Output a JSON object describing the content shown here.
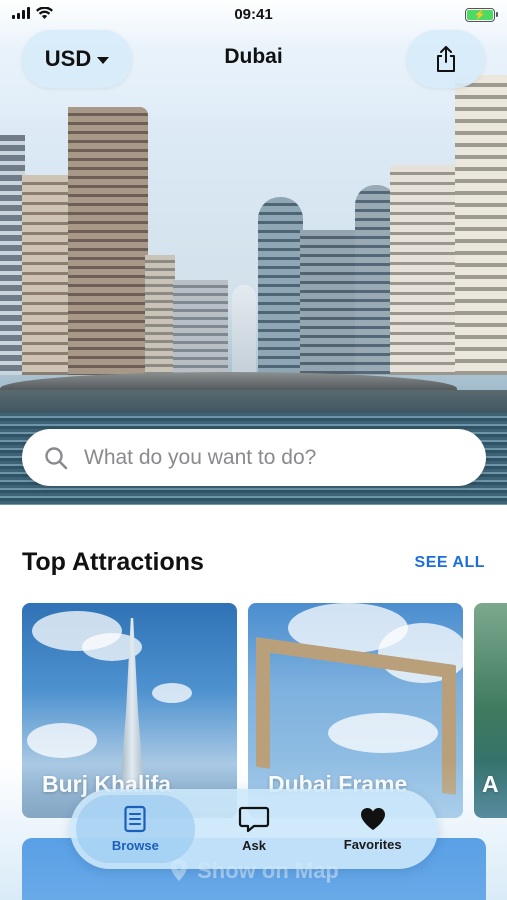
{
  "status_bar": {
    "time": "09:41"
  },
  "header": {
    "currency": "USD",
    "city": "Dubai"
  },
  "search": {
    "placeholder": "What do you want to do?"
  },
  "attractions": {
    "title": "Top Attractions",
    "see_all": "SEE ALL",
    "cards": [
      {
        "label": "Burj Khalifa"
      },
      {
        "label": "Dubai Frame"
      },
      {
        "label": "A"
      }
    ]
  },
  "map_button": {
    "label": "Show on Map"
  },
  "tab_bar": {
    "tabs": [
      {
        "label": "Browse",
        "icon": "document-icon",
        "active": true
      },
      {
        "label": "Ask",
        "icon": "chat-bubble-icon",
        "active": false
      },
      {
        "label": "Favorites",
        "icon": "heart-icon",
        "active": false
      }
    ]
  },
  "colors": {
    "accent": "#1d6fd6",
    "active_tab": "#1b5fb8",
    "map_button": "#1c7bde",
    "battery": "#4cd964"
  }
}
